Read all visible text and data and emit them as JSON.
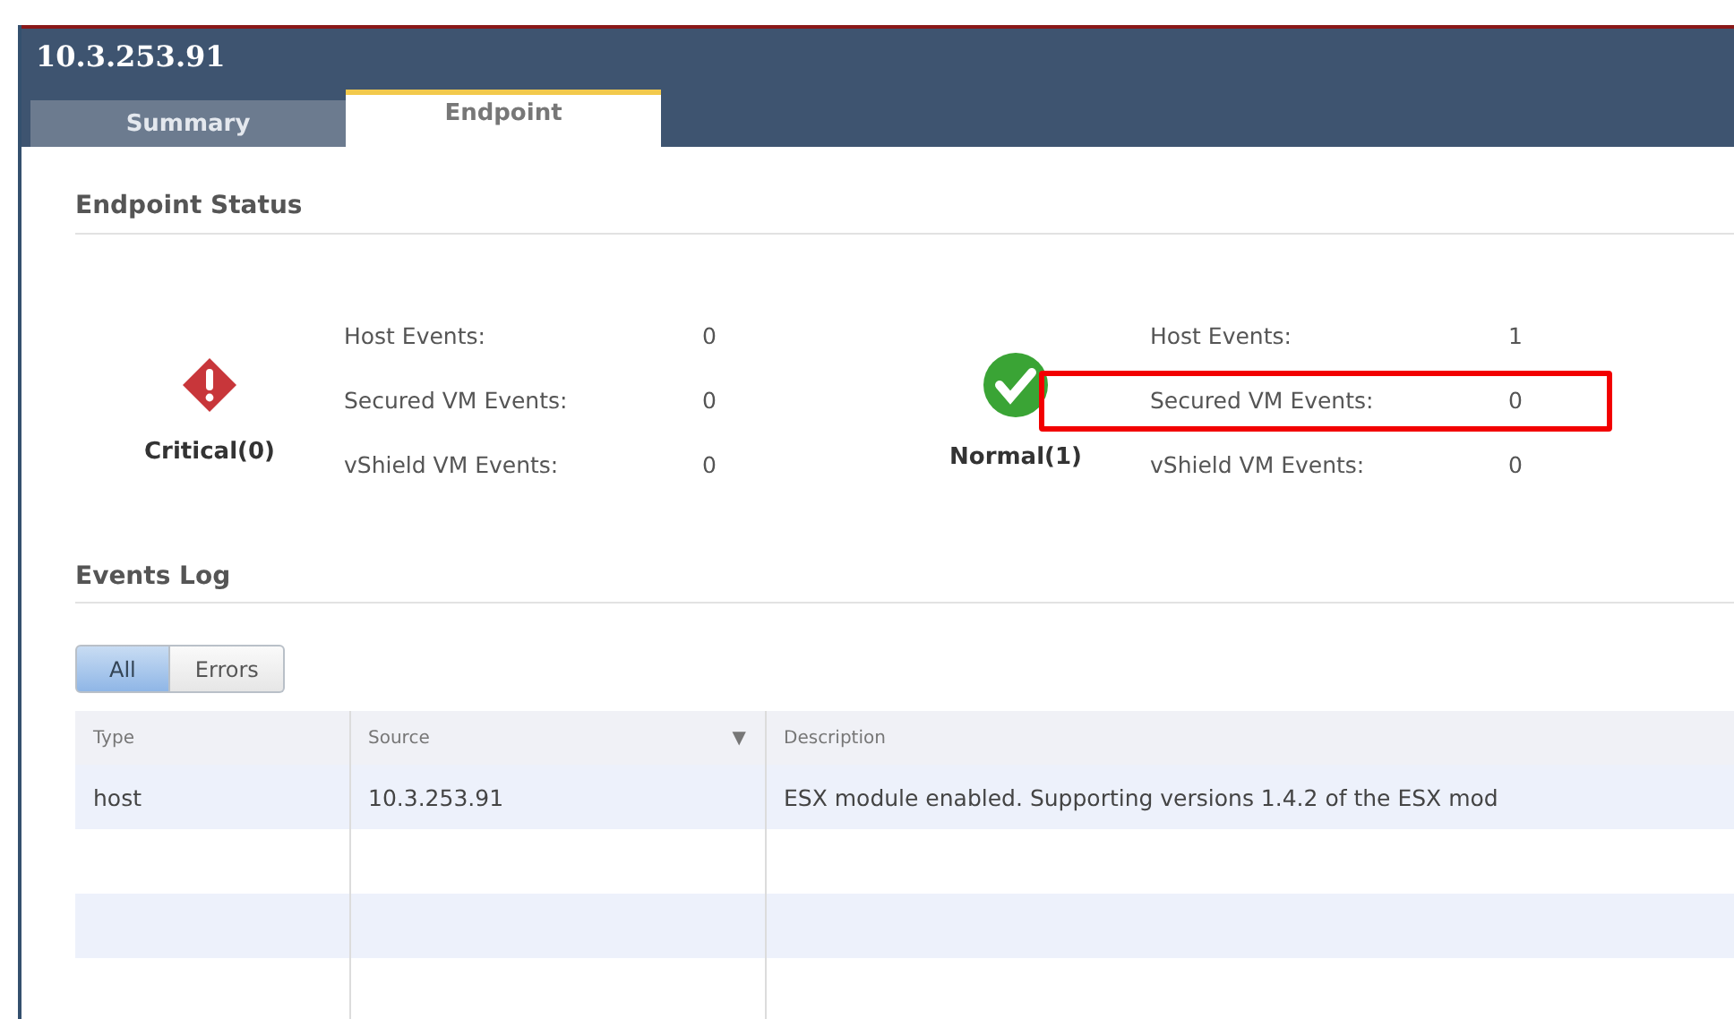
{
  "window": {
    "title": "10.3.253.91"
  },
  "tabs": [
    {
      "label": "Summary",
      "selected": false
    },
    {
      "label": "Endpoint",
      "selected": true
    }
  ],
  "endpoint_status": {
    "heading": "Endpoint Status",
    "groups": [
      {
        "kind": "critical",
        "label": "Critical(0)",
        "rows": [
          {
            "label": "Host Events:",
            "value": "0",
            "highlighted": false
          },
          {
            "label": "Secured VM Events:",
            "value": "0",
            "highlighted": false
          },
          {
            "label": "vShield VM Events:",
            "value": "0",
            "highlighted": false
          }
        ]
      },
      {
        "kind": "normal",
        "label": "Normal(1)",
        "rows": [
          {
            "label": "Host Events:",
            "value": "1",
            "highlighted": false
          },
          {
            "label": "Secured VM Events:",
            "value": "0",
            "highlighted": true
          },
          {
            "label": "vShield VM Events:",
            "value": "0",
            "highlighted": false
          }
        ]
      }
    ]
  },
  "events_log": {
    "heading": "Events Log",
    "filters": [
      {
        "label": "All",
        "selected": true
      },
      {
        "label": "Errors",
        "selected": false
      }
    ],
    "columns": [
      {
        "label": "Type"
      },
      {
        "label": "Source",
        "sort_mark": "▼"
      },
      {
        "label": "Description"
      }
    ],
    "rows": [
      [
        "host",
        "10.3.253.91",
        "ESX module enabled. Supporting versions 1.4.2 of the ESX mod"
      ]
    ]
  }
}
